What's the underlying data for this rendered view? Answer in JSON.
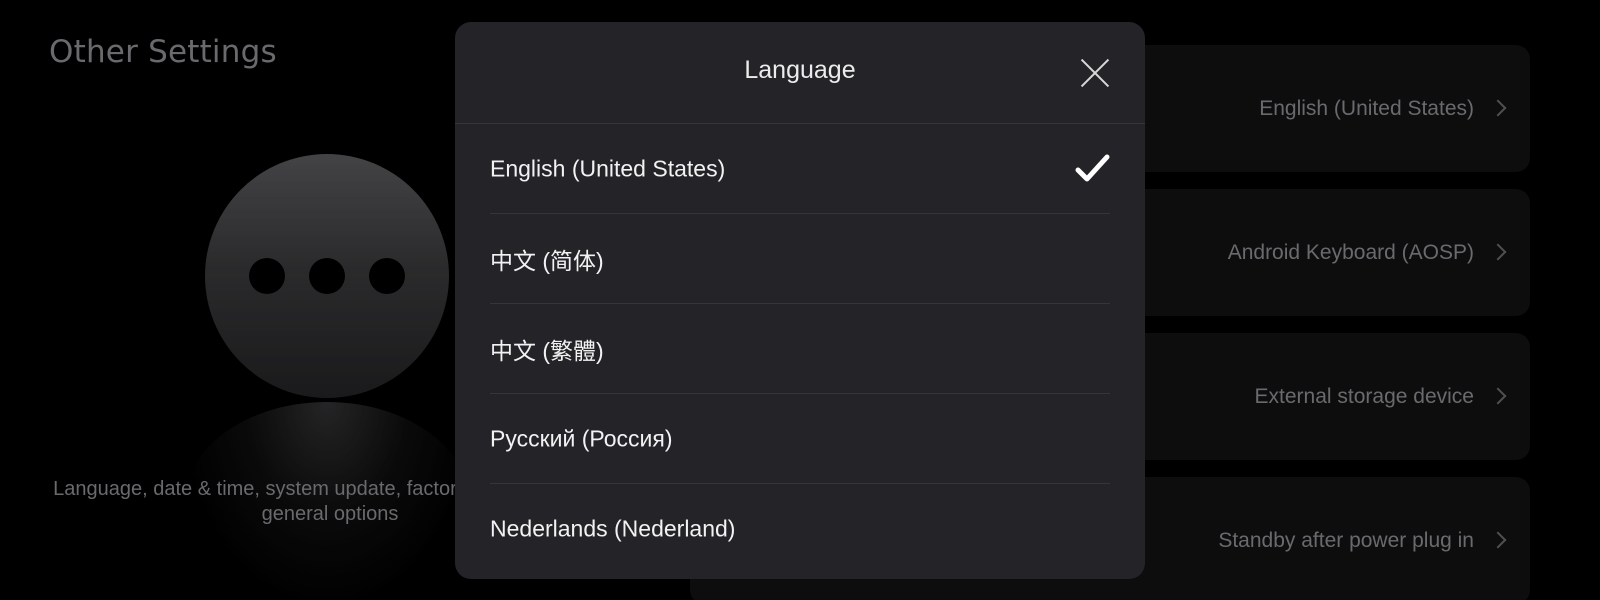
{
  "background": {
    "title": "Other Settings",
    "hero_icon": "more-horizontal-icon",
    "description": "Language, date & time, system update, factory reset and other general options",
    "cards": [
      {
        "value": "English (United States)",
        "icon": "chevron-right-icon"
      },
      {
        "value": "Android Keyboard (AOSP)",
        "icon": "chevron-right-icon"
      },
      {
        "value": "External storage device",
        "icon": "chevron-right-icon"
      },
      {
        "value": "Standby after power plug in",
        "icon": "chevron-right-icon"
      }
    ]
  },
  "dialog": {
    "title": "Language",
    "close_icon": "close-icon",
    "selected_icon": "checkmark-icon",
    "options": [
      {
        "label": "English (United States)",
        "selected": true
      },
      {
        "label": "中文 (简体)",
        "selected": false
      },
      {
        "label": "中文 (繁體)",
        "selected": false
      },
      {
        "label": "Русский (Россия)",
        "selected": false
      },
      {
        "label": "Nederlands (Nederland)",
        "selected": false
      }
    ]
  },
  "colors": {
    "dialog_bg": "#242428",
    "card_bg": "#121213",
    "muted_text": "#8e8e93"
  }
}
